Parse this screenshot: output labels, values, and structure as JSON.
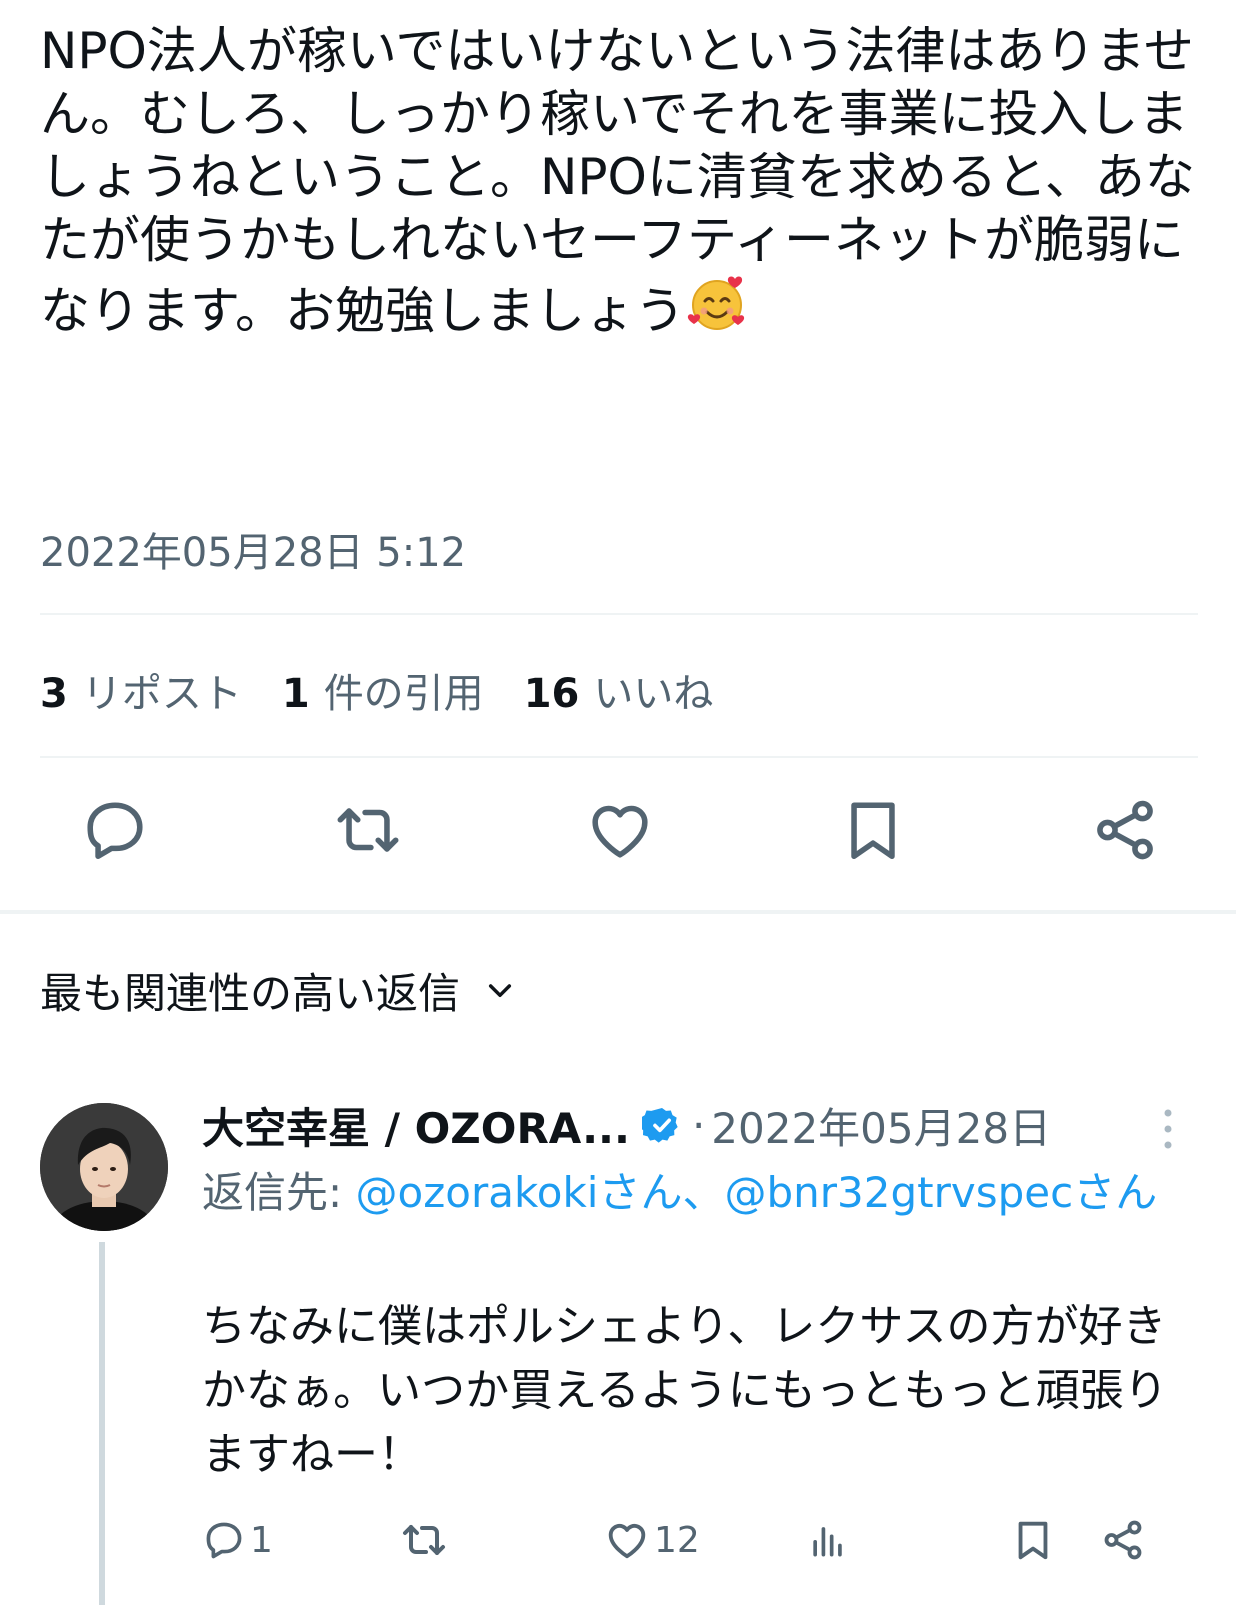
{
  "tweet": {
    "text": "NPO法人が稼いではいけないという法律はありません。むしろ、しっかり稼いでそれを事業に投入しましょうねということ。NPOに清貧を求めると、あなたが使うかもしれないセーフティーネットが脆弱になります。お勉強しましょう",
    "emoji": "smiling-face-with-hearts",
    "timestamp": "2022年05月28日 5:12"
  },
  "stats": {
    "reposts_count": "3",
    "reposts_label": "リポスト",
    "quotes_count": "1",
    "quotes_label": "件の引用",
    "likes_count": "16",
    "likes_label": "いいね"
  },
  "actions": [
    "reply-icon",
    "repost-icon",
    "like-icon",
    "bookmark-icon",
    "share-icon"
  ],
  "replies_sort": {
    "label": "最も関連性の高い返信",
    "icon": "chevron-down-icon"
  },
  "reply": {
    "name": "大空幸星 / OZORA...",
    "separator": "·",
    "timestamp": "2022年05月28日",
    "reply_to_label": "返信先:",
    "mention_1": "@ozorakokiさん",
    "mention_sep": "、",
    "mention_2": "@bnr32gtrvspecさん",
    "text": "ちなみに僕はポルシェより、レクサスの方が好きかなぁ。いつか買えるようにもっともっと頑張りますねー！",
    "reply_count": "1",
    "like_count": "12"
  },
  "colors": {
    "text": "#0f1419",
    "secondary": "#536471",
    "accent": "#1d9bf0",
    "divider": "#eff3f4"
  }
}
